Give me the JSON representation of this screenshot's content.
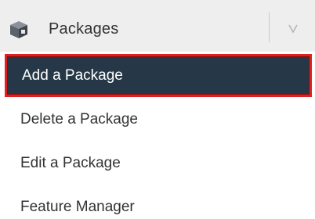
{
  "header": {
    "title": "Packages",
    "icon": "package-box-icon",
    "chevron_icon": "chevron-down-icon"
  },
  "menu": {
    "items": [
      {
        "label": "Add a Package",
        "active": true
      },
      {
        "label": "Delete a Package",
        "active": false
      },
      {
        "label": "Edit a Package",
        "active": false
      },
      {
        "label": "Feature Manager",
        "active": false
      }
    ]
  },
  "colors": {
    "header_bg": "#eeeeee",
    "active_bg": "#263847",
    "active_border": "#e02020",
    "text": "#333333"
  }
}
